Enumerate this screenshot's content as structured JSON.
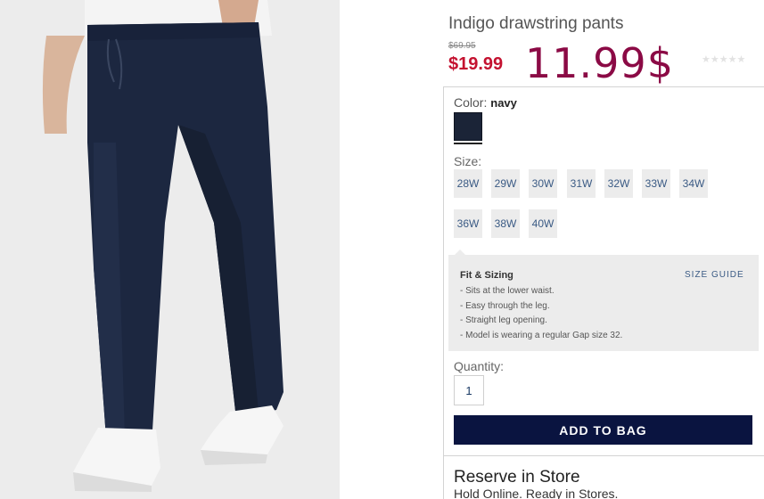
{
  "product": {
    "title": "Indigo drawstring pants",
    "old_price": "$69.95",
    "sale_price": "$19.99",
    "overlay_price": "11.99$",
    "rating_stars": "★★★★★",
    "rating_value": 0
  },
  "color": {
    "label": "Color:",
    "selected": "navy",
    "swatch_color": "#1b2437"
  },
  "size": {
    "label": "Size:",
    "options": [
      "28W",
      "29W",
      "30W",
      "31W",
      "32W",
      "33W",
      "34W",
      "36W",
      "38W",
      "40W"
    ]
  },
  "fit": {
    "title": "Fit & Sizing",
    "size_guide": "SIZE GUIDE",
    "items": [
      "- Sits at the lower waist.",
      "- Easy through the leg.",
      "- Straight leg opening.",
      "- Model is wearing a regular Gap size 32."
    ]
  },
  "quantity": {
    "label": "Quantity:",
    "value": "1"
  },
  "add_to_bag": "ADD TO BAG",
  "reserve": {
    "title": "Reserve in Store",
    "subtitle": "Hold Online. Ready in Stores."
  },
  "colors": {
    "sale_red": "#c41230",
    "overlay": "#8b0a45",
    "button_navy": "#0a1440",
    "link_blue": "#3a5a84"
  }
}
